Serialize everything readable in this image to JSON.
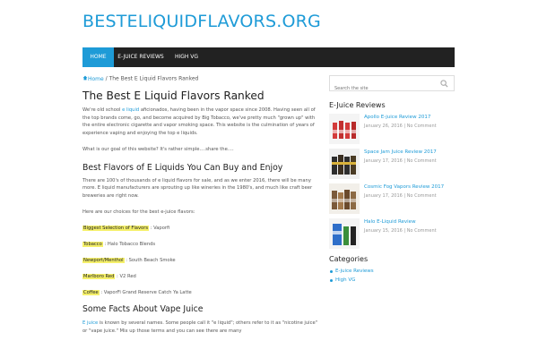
{
  "site": {
    "title": "BESTELIQUIDFLAVORS.ORG"
  },
  "nav": {
    "items": [
      "HOME",
      "E-JUICE REVIEWS",
      "HIGH VG"
    ],
    "active": "HOME"
  },
  "breadcrumb": {
    "home": "Home",
    "separator": "/",
    "current": "The Best E Liquid Flavors Ranked"
  },
  "article": {
    "title": "The Best E Liquid Flavors Ranked",
    "intro_1a": "We're old school ",
    "intro_link": "e liquid",
    "intro_1b": " aficionados, having been in the vapor space since 2008. Having seen all of the top brands come, go, and become acquired by Big Tobacco, we've pretty much \"grown up\" with the entire electronic cigarette and vapor smoking space.  This website is the culmination of years of experience vaping and enjoying the top e liquids.",
    "intro_2": "What is our goal of this website? It's rather simple….share the….",
    "section_1_heading": "Best Flavors of E Liquids You Can Buy and Enjoy",
    "section_1_p": "There are 100's of thousands of e liquid flavors for sale, and as we enter 2016, there will be many more.  E liquid manufacturers are sprouting up like wineries in the 1980's, and much like craft beer breweries are right now.",
    "choices_intro": "Here are our choices for the best e-juice flavors:",
    "choices": [
      {
        "label": "Biggest Selection of Flavors",
        "value": " : Vaporfi"
      },
      {
        "label": "Tobacco",
        "value": " : Halo Tobacco Blends"
      },
      {
        "label": "Newport/Menthol",
        "value": " : South Beach Smoke"
      },
      {
        "label": "Marlboro Red",
        "value": " : V2 Red"
      },
      {
        "label": "Coffee",
        "value": " : VaporFi Grand Reserve Catch Ya Latte"
      }
    ],
    "section_2_heading": "Some Facts About Vape Juice",
    "section_2_link": "E juice",
    "section_2_p": " is known by several names. Some people call it \"e liquid\"; others refer to it as \"nicotine juice\" or \"vape juice.\" Mix up those terms and you can see there are many"
  },
  "sidebar": {
    "search_placeholder": "Search the site",
    "reviews_title": "E-Juice Reviews",
    "reviews": [
      {
        "title": "Apollo E-juice Review 2017",
        "date": "January 26, 2016",
        "comments": "No Comment",
        "thumb": "#d33b3b"
      },
      {
        "title": "Space Jam Juice Review 2017",
        "date": "January 17, 2016",
        "comments": "No Comment",
        "thumb": "#2d2d2d"
      },
      {
        "title": "Cosmic Fog Vapors Review 2017",
        "date": "January 17, 2016",
        "comments": "No Comment",
        "thumb": "#7b5a3a"
      },
      {
        "title": "Halo E-Liquid Review",
        "date": "January 15, 2016",
        "comments": "No Comment",
        "thumb": "#2f6fc9"
      }
    ],
    "categories_title": "Categories",
    "categories": [
      "E-juice Reviews",
      "High VG"
    ]
  },
  "colors": {
    "accent": "#1e9bd7",
    "nav_bg": "#222222",
    "highlight": "#f5f06a"
  }
}
